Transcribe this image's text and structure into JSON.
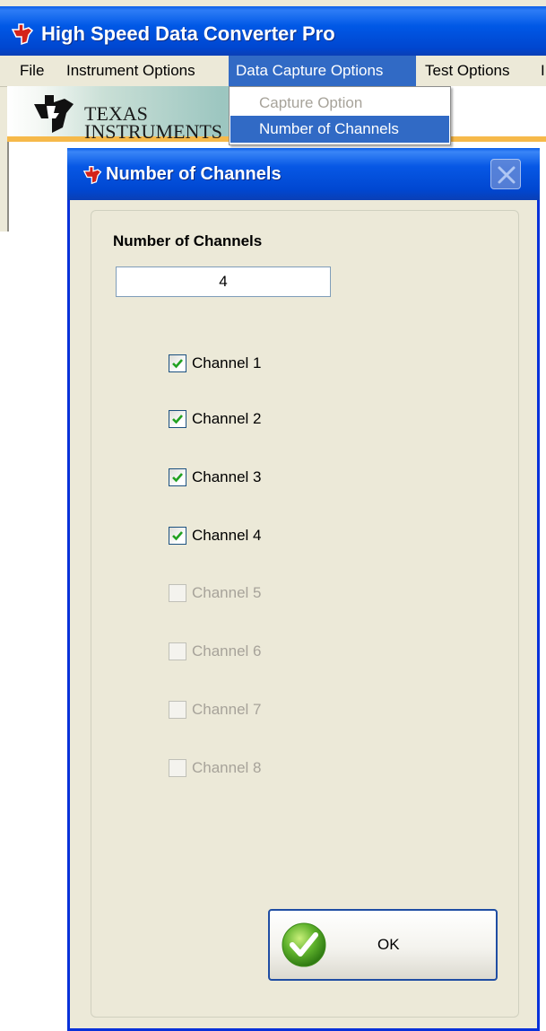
{
  "app": {
    "title": "High Speed Data Converter Pro",
    "brand_line1": "TEXAS",
    "brand_line2": "INSTRUMENTS"
  },
  "menubar": {
    "items": [
      "File",
      "Instrument Options",
      "Data Capture Options",
      "Test Options",
      "I"
    ],
    "active": "Data Capture Options"
  },
  "dropdown": {
    "items": [
      {
        "label": "Capture Option",
        "state": "disabled"
      },
      {
        "label": "Number of Channels",
        "state": "highlighted"
      }
    ]
  },
  "dialog": {
    "title": "Number of Channels",
    "field_label": "Number of Channels",
    "field_value": "4",
    "channels": [
      {
        "label": "Channel 1",
        "checked": true,
        "enabled": true
      },
      {
        "label": "Channel 2",
        "checked": true,
        "enabled": true
      },
      {
        "label": "Channel 3",
        "checked": true,
        "enabled": true
      },
      {
        "label": "Channel 4",
        "checked": true,
        "enabled": true
      },
      {
        "label": "Channel 5",
        "checked": false,
        "enabled": false
      },
      {
        "label": "Channel 6",
        "checked": false,
        "enabled": false
      },
      {
        "label": "Channel 7",
        "checked": false,
        "enabled": false
      },
      {
        "label": "Channel 8",
        "checked": false,
        "enabled": false
      }
    ],
    "ok_label": "OK"
  },
  "colors": {
    "titlebar": "#0054e3",
    "menu_highlight": "#316ac5",
    "window_face": "#ece9d8",
    "check_green": "#21a121",
    "banner_stripe": "#f6b94a"
  },
  "icons": [
    "app-icon",
    "ti-logo-icon",
    "close-icon",
    "checkmark-icon",
    "ok-check-icon"
  ]
}
